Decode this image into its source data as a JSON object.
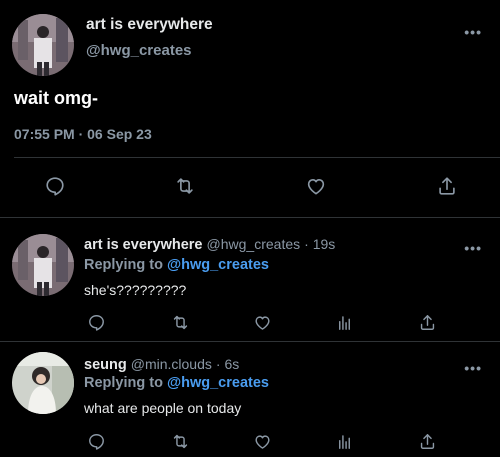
{
  "main_tweet": {
    "display_name": "art is everywhere",
    "handle": "@hwg_creates",
    "more_icon": "more-dots-icon",
    "text": "wait omg-",
    "timestamp": "07:55 PM · 06 Sep 23",
    "actions": [
      "reply-icon",
      "retweet-icon",
      "like-icon",
      "share-icon"
    ]
  },
  "replies": [
    {
      "display_name": "art is everywhere",
      "handle": "@hwg_creates",
      "time": "· 19s",
      "replying_prefix": "Replying to",
      "replying_to": "@hwg_creates",
      "text": "she's?????????",
      "actions": [
        "reply-icon",
        "retweet-icon",
        "like-icon",
        "analytics-icon",
        "share-icon"
      ]
    },
    {
      "display_name": "seung",
      "handle": "@min.clouds",
      "time": "· 6s",
      "replying_prefix": "Replying to",
      "replying_to": "@hwg_creates",
      "text": "what are people on today",
      "actions": [
        "reply-icon",
        "retweet-icon",
        "like-icon",
        "analytics-icon",
        "share-icon"
      ]
    }
  ],
  "colors": {
    "background": "#000000",
    "text": "#e7e9ea",
    "muted": "#8b98a5",
    "link": "#4a9df0",
    "divider": "#2f3336"
  }
}
